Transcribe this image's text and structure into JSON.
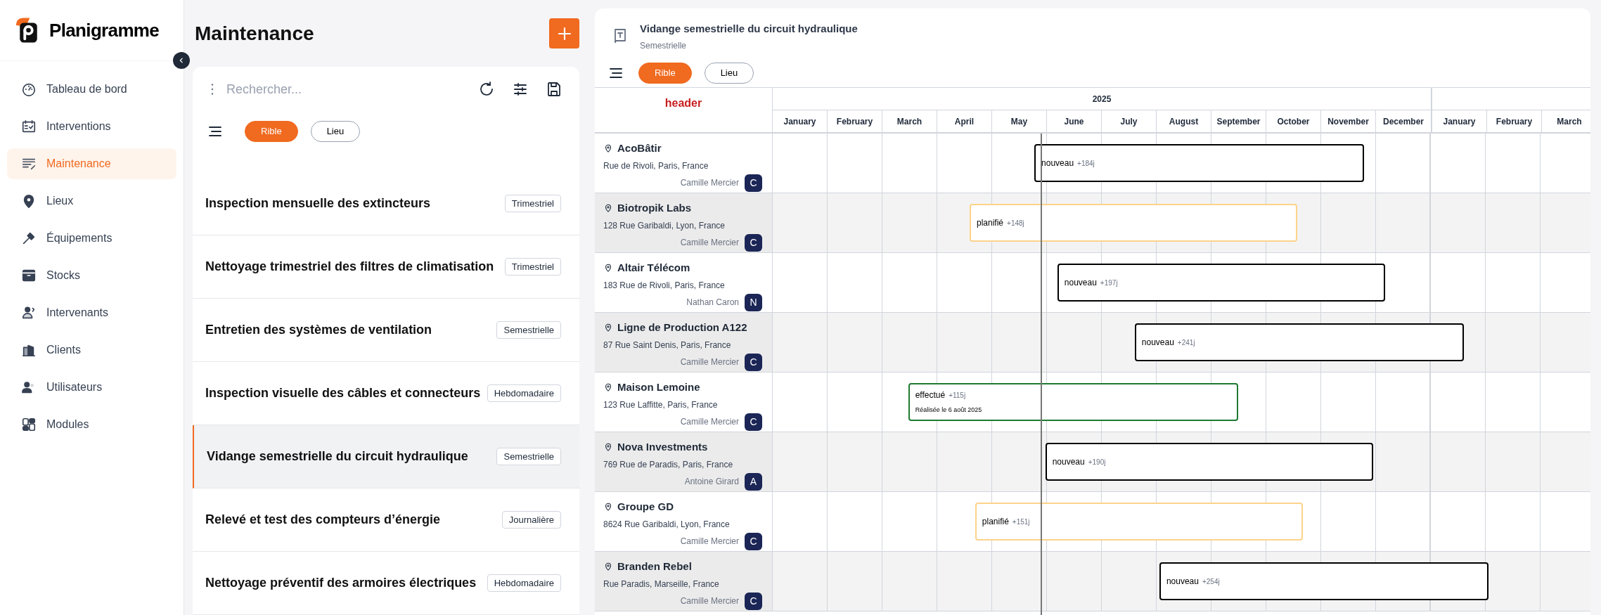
{
  "sidebar": {
    "logo_text": "Planigramme",
    "items": [
      {
        "label": "Tableau de bord",
        "selected": false
      },
      {
        "label": "Interventions",
        "selected": false
      },
      {
        "label": "Maintenance",
        "selected": true
      },
      {
        "label": "Lieux",
        "selected": false
      },
      {
        "label": "Équipements",
        "selected": false
      },
      {
        "label": "Stocks",
        "selected": false
      },
      {
        "label": "Intervenants",
        "selected": false
      },
      {
        "label": "Clients",
        "selected": false
      },
      {
        "label": "Utilisateurs",
        "selected": false
      },
      {
        "label": "Modules",
        "selected": false
      }
    ]
  },
  "main": {
    "title": "Maintenance",
    "search": {
      "placeholder": "Rechercher..."
    },
    "group_chips": [
      {
        "label": "Rible",
        "selected": true
      },
      {
        "label": "Lieu",
        "selected": false
      }
    ],
    "plans": [
      {
        "title": "Inspection mensuelle des extincteurs",
        "frequency": "Trimestriel",
        "selected": false
      },
      {
        "title": "Nettoyage trimestriel des filtres de climatisation",
        "frequency": "Trimestriel",
        "selected": false
      },
      {
        "title": "Entretien des systèmes de ventilation",
        "frequency": "Semestrielle",
        "selected": false
      },
      {
        "title": "Inspection visuelle des câbles et connecteurs",
        "frequency": "Hebdomadaire",
        "selected": false
      },
      {
        "title": "Vidange semestrielle du circuit hydraulique",
        "frequency": "Semestrielle",
        "selected": true
      },
      {
        "title": "Relevé et test des compteurs d’énergie",
        "frequency": "Journalière",
        "selected": false
      },
      {
        "title": "Nettoyage préventif des armoires électriques",
        "frequency": "Hebdomadaire",
        "selected": false
      }
    ]
  },
  "detail": {
    "title": "Vidange semestrielle du circuit hydraulique",
    "subtitle": "Semestrielle",
    "group_chips": [
      {
        "label": "Rible",
        "selected": true
      },
      {
        "label": "Lieu",
        "selected": false
      }
    ],
    "gantt": {
      "header_label": "header",
      "years": [
        {
          "label": "2025",
          "months": [
            "January",
            "February",
            "March",
            "April",
            "May",
            "June",
            "July",
            "August",
            "September",
            "October",
            "November",
            "December"
          ]
        },
        {
          "months": [
            "January",
            "February",
            "March"
          ]
        }
      ],
      "rows": [
        {
          "name": "AcoBâtir",
          "address": "Rue de Rivoli, Paris, France",
          "person": "Camille Mercier",
          "initial": "C",
          "bar": {
            "kind": "new",
            "status": "nouveau",
            "delay": "+184j"
          }
        },
        {
          "name": "Biotropik Labs",
          "address": "128 Rue Garibaldi, Lyon, France",
          "person": "Camille Mercier",
          "initial": "C",
          "bar": {
            "kind": "planned",
            "status": "planifié",
            "delay": "+148j"
          }
        },
        {
          "name": "Altair Télécom",
          "address": "183 Rue de Rivoli, Paris, France",
          "person": "Nathan Caron",
          "initial": "N",
          "bar": {
            "kind": "new",
            "status": "nouveau",
            "delay": "+197j"
          }
        },
        {
          "name": "Ligne de Production A122",
          "address": "87 Rue Saint Denis, Paris, France",
          "person": "Camille Mercier",
          "initial": "C",
          "bar": {
            "kind": "new",
            "status": "nouveau",
            "delay": "+241j"
          }
        },
        {
          "name": "Maison Lemoine",
          "address": "123 Rue Laffitte, Paris, France",
          "person": "Camille Mercier",
          "initial": "C",
          "bar": {
            "kind": "done",
            "status": "effectué",
            "delay": "+115j",
            "note": "Réalisée le 6 août 2025"
          }
        },
        {
          "name": "Nova Investments",
          "address": "769 Rue de Paradis, Paris, France",
          "person": "Antoine Girard",
          "initial": "A",
          "bar": {
            "kind": "new",
            "status": "nouveau",
            "delay": "+190j"
          }
        },
        {
          "name": "Groupe GD",
          "address": "8624 Rue Garibaldi, Lyon, France",
          "person": "Camille Mercier",
          "initial": "C",
          "bar": {
            "kind": "planned",
            "status": "planifié",
            "delay": "+151j"
          }
        },
        {
          "name": "Branden Rebel",
          "address": "Rue Paradis, Marseille, France",
          "person": "Camille Mercier",
          "initial": "C",
          "bar": {
            "kind": "new",
            "status": "nouveau",
            "delay": "+254j"
          }
        }
      ]
    }
  }
}
